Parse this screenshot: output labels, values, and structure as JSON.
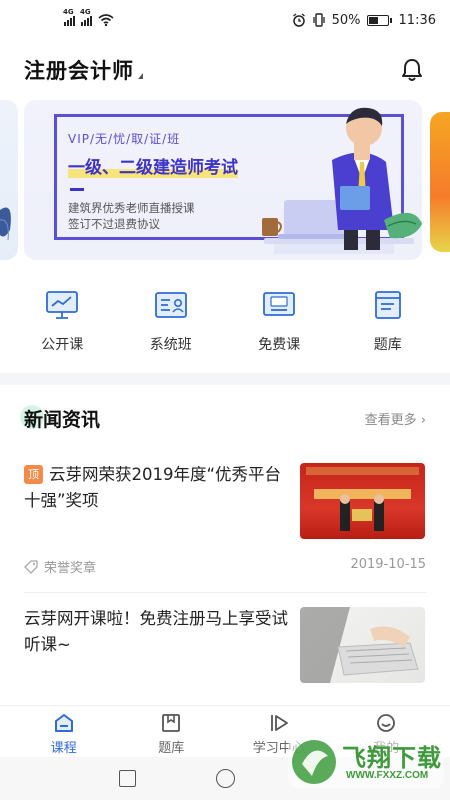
{
  "status": {
    "battery": "50%",
    "time": "11:36",
    "signal_label": "4G"
  },
  "header": {
    "title": "注册会计师"
  },
  "banner": {
    "vip_line": "VIP/无/忧/取/证/班",
    "headline": "一级、二级建造师考试",
    "line1": "建筑界优秀老师直播授课",
    "line2": "签订不过退费协议"
  },
  "quick_menu": [
    {
      "label": "公开课",
      "icon": "live-monitor-icon"
    },
    {
      "label": "系统班",
      "icon": "class-card-icon"
    },
    {
      "label": "免费课",
      "icon": "free-course-icon"
    },
    {
      "label": "题库",
      "icon": "question-bank-icon"
    }
  ],
  "news": {
    "title": "新闻资讯",
    "more": "查看更多",
    "items": [
      {
        "badge": "顶",
        "title": "云芽网荣获2019年度“优秀平台十强”奖项",
        "tag": "荣誉奖章",
        "date": "2019-10-15"
      },
      {
        "title": "云芽网开课啦！免费注册马上享受试听课~"
      }
    ]
  },
  "tabbar": [
    {
      "label": "课程",
      "active": true
    },
    {
      "label": "题库",
      "active": false
    },
    {
      "label": "学习中心",
      "active": false
    },
    {
      "label": "我的",
      "active": false
    }
  ],
  "watermark": {
    "text": "飞翔下载",
    "url": "WWW.FXXZ.COM"
  },
  "colors": {
    "accent": "#2f6bd6",
    "banner_purple": "#5a4fd6",
    "badge_orange": "#f28b4a"
  }
}
